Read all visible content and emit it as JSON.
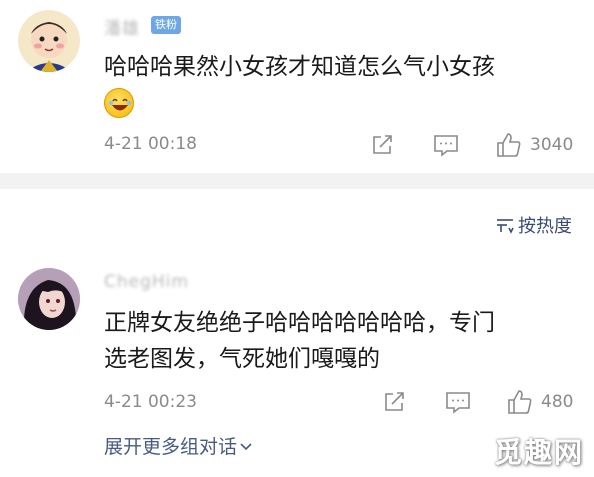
{
  "comments": [
    {
      "username": "潘雄",
      "badge": "铁粉",
      "text": "哈哈哈果然小女孩才知道怎么气小女孩",
      "time": "4-21 00:18",
      "likes": "3040"
    },
    {
      "username": "ChegHim",
      "text_line1": "正牌女友绝绝子哈哈哈哈哈哈哈，专门",
      "text_line2": "选老图发，气死她们嘎嘎的",
      "time": "4-21 00:23",
      "likes": "480"
    }
  ],
  "sort_label": "按热度",
  "expand_label": "展开更多组对话",
  "watermark": "觅趣网",
  "icons": [
    "share-icon",
    "comment-icon",
    "like-icon",
    "sort-icon",
    "chevron-down-icon",
    "laugh-emoji-icon"
  ]
}
